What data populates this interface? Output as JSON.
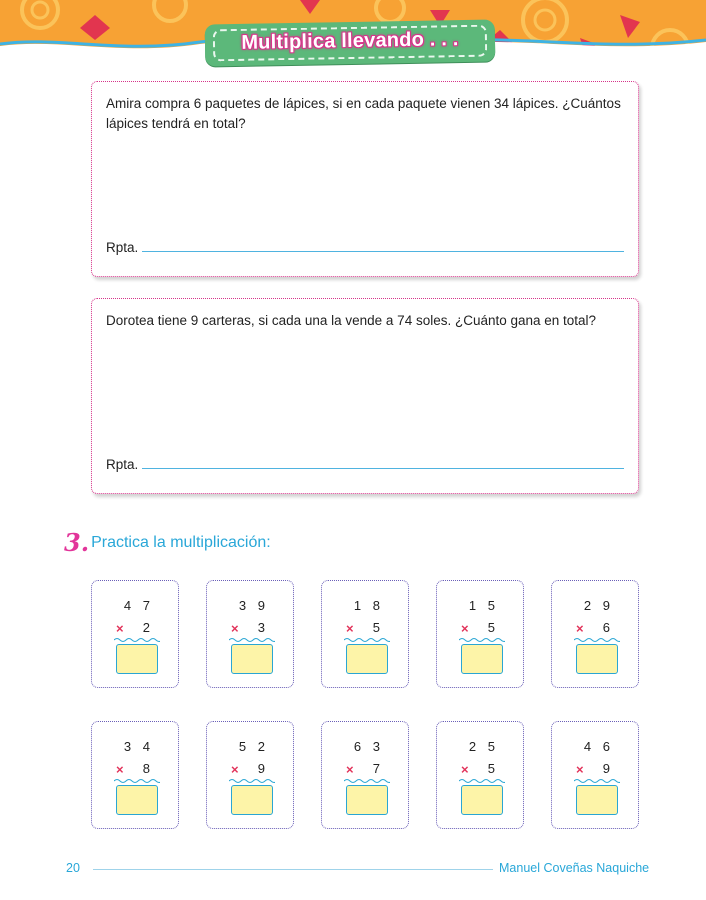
{
  "header": {
    "title": "Multiplica llevando . . .",
    "band_color": "#f7a234",
    "banner_color": "#5cb87a"
  },
  "problems": [
    {
      "text": "Amira compra 6 paquetes de lápices, si en cada paquete vienen 34 lápices. ¿Cuántos lápices tendrá en total?",
      "answer_label": "Rpta."
    },
    {
      "text": "Dorotea tiene 9 carteras, si cada una la vende a 74 soles. ¿Cuánto gana en total?",
      "answer_label": "Rpta."
    }
  ],
  "section": {
    "number": "3.",
    "title": "Practica la multiplicación:"
  },
  "exercises": [
    {
      "top": "4 7",
      "operator": "×",
      "multiplier": "2"
    },
    {
      "top": "3 9",
      "operator": "×",
      "multiplier": "3"
    },
    {
      "top": "1 8",
      "operator": "×",
      "multiplier": "5"
    },
    {
      "top": "1 5",
      "operator": "×",
      "multiplier": "5"
    },
    {
      "top": "2 9",
      "operator": "×",
      "multiplier": "6"
    },
    {
      "top": "3 4",
      "operator": "×",
      "multiplier": "8"
    },
    {
      "top": "5 2",
      "operator": "×",
      "multiplier": "9"
    },
    {
      "top": "6 3",
      "operator": "×",
      "multiplier": "7"
    },
    {
      "top": "2 5",
      "operator": "×",
      "multiplier": "5"
    },
    {
      "top": "4 6",
      "operator": "×",
      "multiplier": "9"
    }
  ],
  "footer": {
    "page_number": "20",
    "author": "Manuel Coveñas Naquiche"
  }
}
